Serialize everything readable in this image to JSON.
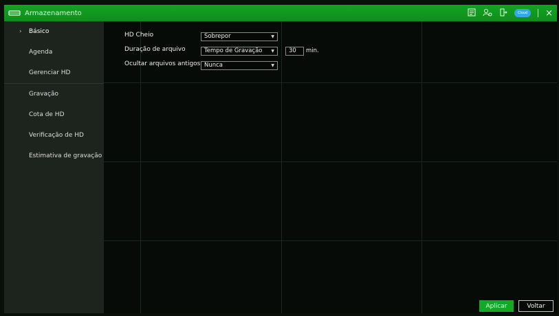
{
  "window": {
    "title": "Armazenamento"
  },
  "toolbar": {
    "icons": [
      "faq-icon",
      "user-icon",
      "logout-icon",
      "cloud-icon",
      "close-icon"
    ],
    "cloud_label": "Cloud"
  },
  "sidebar": {
    "items": [
      {
        "label": "Básico"
      },
      {
        "label": "Agenda"
      },
      {
        "label": "Gerenciar HD"
      },
      {
        "label": "Gravação"
      },
      {
        "label": "Cota de HD"
      },
      {
        "label": "Verificação de HD"
      },
      {
        "label": "Estimativa de gravação"
      }
    ]
  },
  "form": {
    "hd_full": {
      "label": "HD Cheio",
      "value": "Sobrepor"
    },
    "file_duration": {
      "label": "Duração de arquivo",
      "value": "Tempo de Gravação",
      "minutes": "30",
      "unit": "min."
    },
    "hide_old": {
      "label": "Ocultar arquivos antigos",
      "value": "Nunca"
    }
  },
  "footer": {
    "apply": "Aplicar",
    "back": "Voltar"
  },
  "colors": {
    "accent": "#14a827",
    "sidebar_bg": "#1d241d",
    "main_bg": "#070b07"
  }
}
